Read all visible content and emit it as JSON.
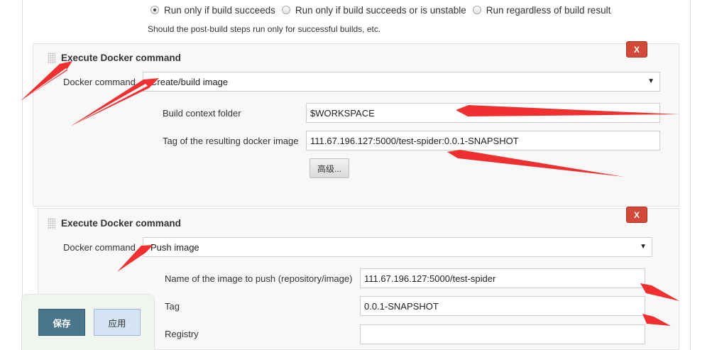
{
  "condition": {
    "options": [
      {
        "label": "Run only if build succeeds",
        "selected": true
      },
      {
        "label": "Run only if build succeeds or is unstable",
        "selected": false
      },
      {
        "label": "Run regardless of build result",
        "selected": false
      }
    ],
    "hint": "Should the post-build steps run only for successful builds, etc."
  },
  "step1": {
    "title": "Execute Docker command",
    "delete_label": "X",
    "docker_command_label": "Docker command",
    "docker_command_value": "Create/build image",
    "build_context_label": "Build context folder",
    "build_context_value": "$WORKSPACE",
    "tag_label": "Tag of the resulting docker image",
    "tag_value": "111.67.196.127:5000/test-spider:0.0.1-SNAPSHOT",
    "advanced_label": "高级..."
  },
  "step2": {
    "title": "Execute Docker command",
    "delete_label": "X",
    "docker_command_label": "Docker command",
    "docker_command_value": "Push image",
    "image_name_label": "Name of the image to push (repository/image)",
    "image_name_value": "111.67.196.127:5000/test-spider",
    "tag_label": "Tag",
    "tag_value": "0.0.1-SNAPSHOT",
    "registry_label": "Registry",
    "registry_value": ""
  },
  "footer": {
    "save_label": "保存",
    "apply_label": "应用"
  },
  "colors": {
    "annotation_arrow": "#f03030",
    "delete_button": "#d24939",
    "save_button": "#4b758b",
    "apply_button": "#d5e4f5"
  },
  "icons": {
    "dropdown": "caret-down-icon",
    "drag_handle": "grip-icon",
    "radio": "radio-icon"
  }
}
